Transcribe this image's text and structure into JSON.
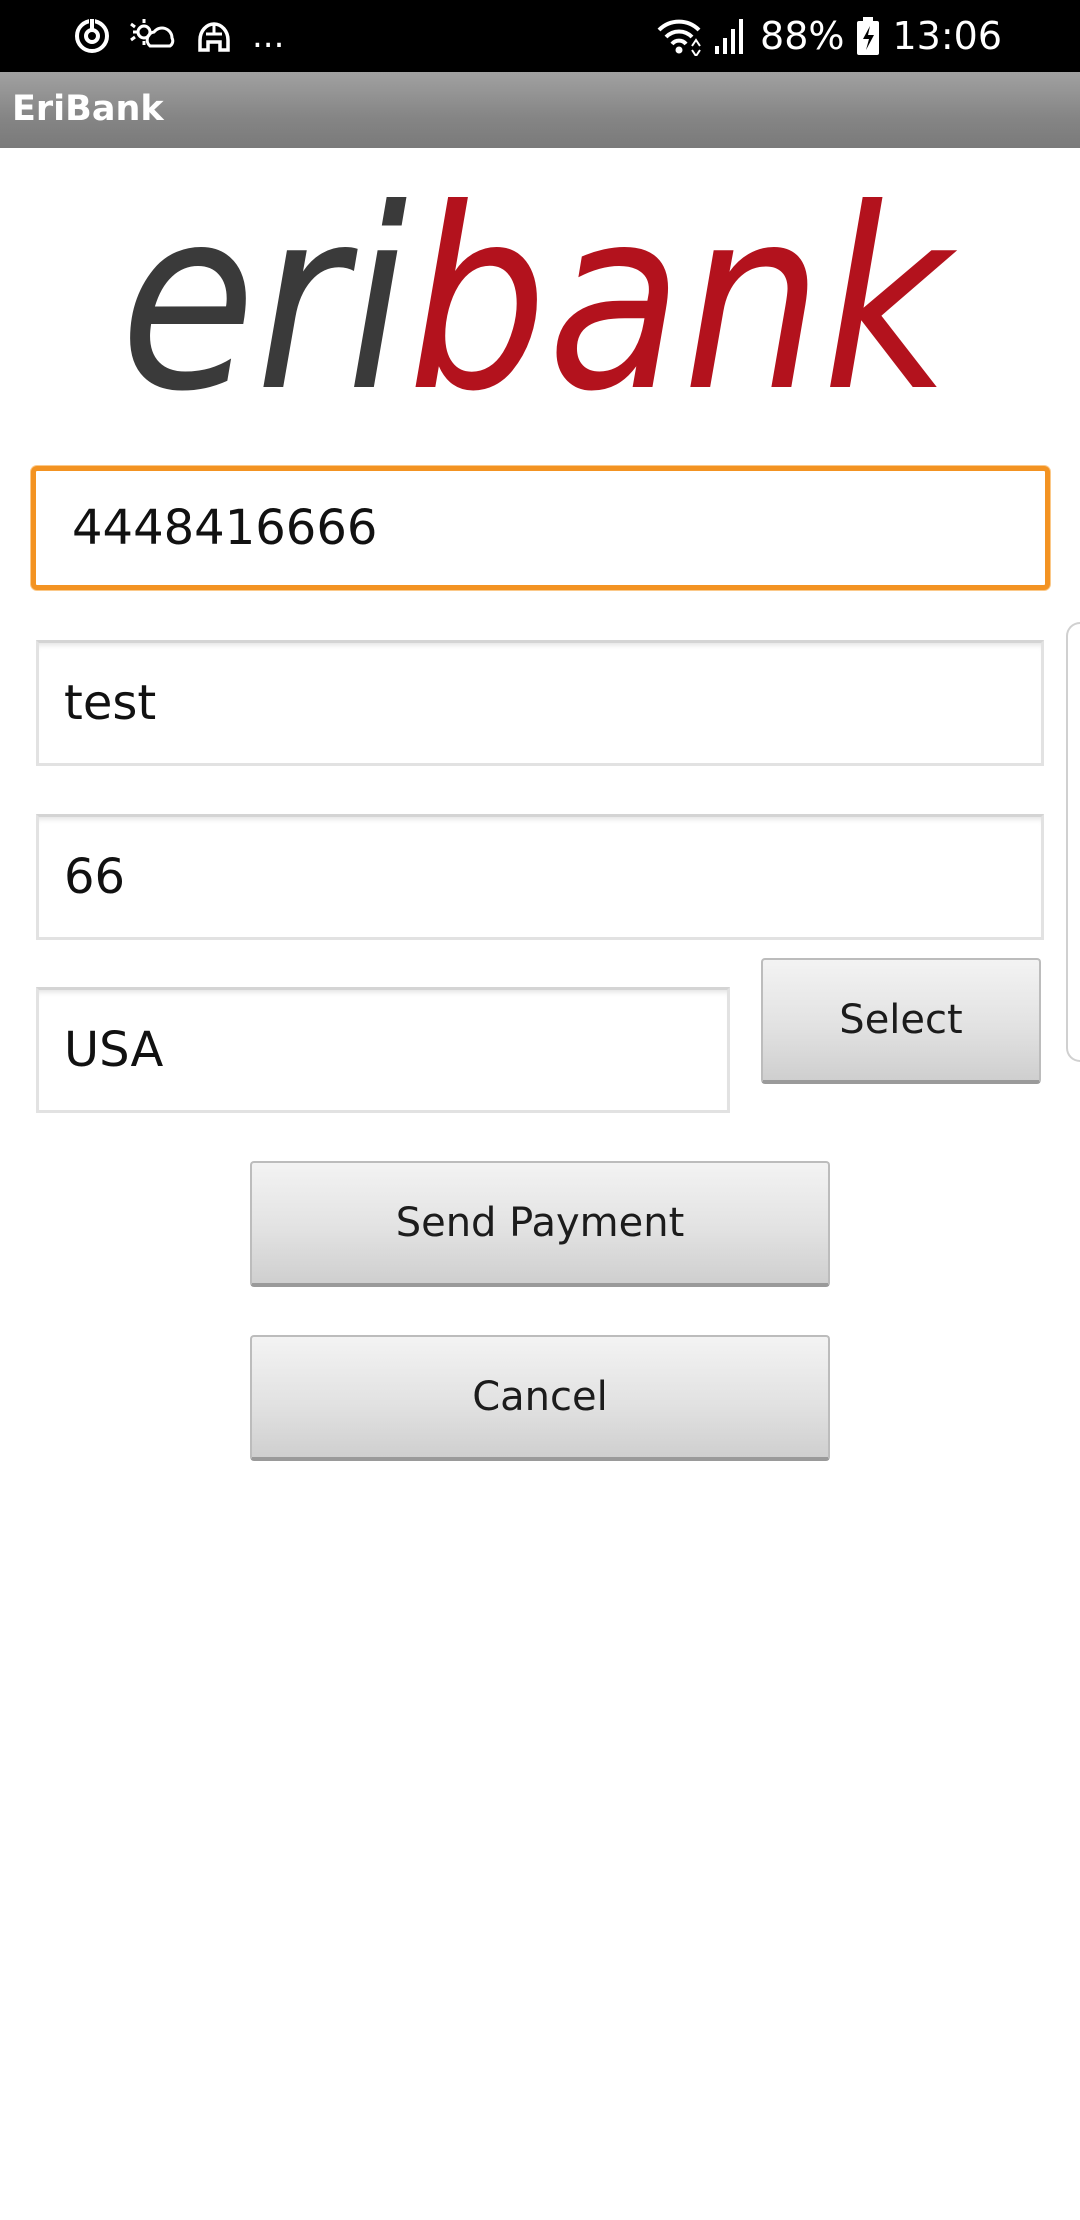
{
  "status_bar": {
    "battery": "88%",
    "time": "13:06",
    "left_icons": [
      "sync-icon",
      "weather-icon",
      "helmet-icon"
    ],
    "ellipsis": "...",
    "right_icons": [
      "wifi-icon",
      "signal-icon",
      "battery-icon"
    ]
  },
  "app": {
    "title": "EriBank",
    "logo_text_dark": "eri",
    "logo_text_red": "bank",
    "brand_dark": "#3a3a3a",
    "brand_red": "#b3121d"
  },
  "form": {
    "phone_value": "4448416666",
    "name_value": "test",
    "amount_value": "66",
    "country_value": "USA",
    "select_label": "Select",
    "send_label": "Send Payment",
    "cancel_label": "Cancel",
    "focus_color": "#f39322"
  }
}
